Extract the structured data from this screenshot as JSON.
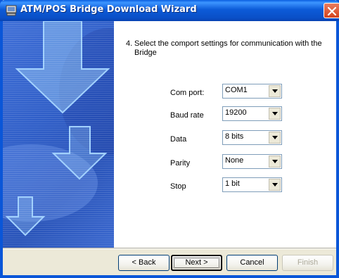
{
  "window": {
    "title": "ATM/POS Bridge Download Wizard"
  },
  "step": {
    "number": "4.",
    "text": "Select the comport settings for communication with the Bridge"
  },
  "fields": [
    {
      "label": "Com port:",
      "value": "COM1"
    },
    {
      "label": "Baud rate",
      "value": "19200"
    },
    {
      "label": "Data",
      "value": "8 bits"
    },
    {
      "label": "Parity",
      "value": "None"
    },
    {
      "label": "Stop",
      "value": "1 bit"
    }
  ],
  "buttons": {
    "back": "< Back",
    "next": "Next >",
    "cancel": "Cancel",
    "finish": "Finish"
  },
  "icons": {
    "app": "computer-icon",
    "close": "close-icon",
    "dropdown": "chevron-down-icon"
  },
  "colors": {
    "title_bar": "#0a56d8",
    "side_panel": "#2f5ec8",
    "close_button": "#d5431c"
  }
}
